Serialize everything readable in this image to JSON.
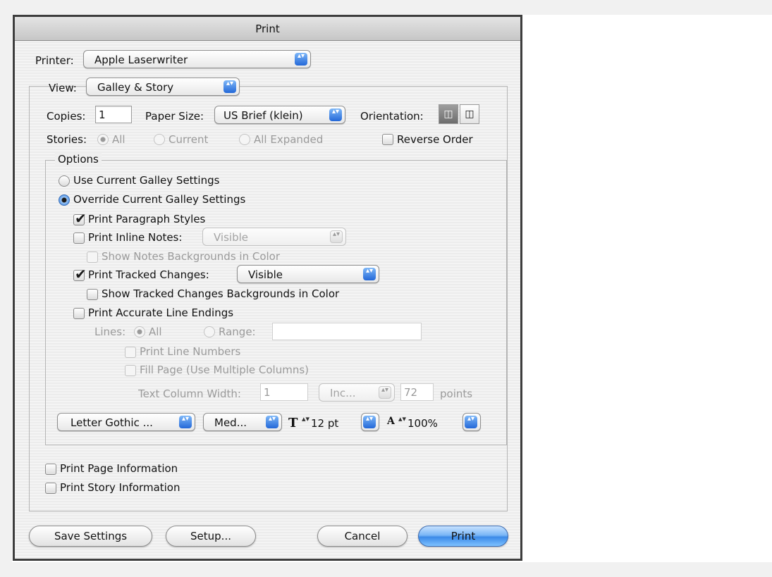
{
  "window": {
    "title": "Print"
  },
  "printer": {
    "label": "Printer:",
    "value": "Apple Laserwriter"
  },
  "view": {
    "label": "View:",
    "value": "Galley & Story"
  },
  "copies": {
    "label": "Copies:",
    "value": "1"
  },
  "paper_size": {
    "label": "Paper Size:",
    "value": "US Brief (klein)"
  },
  "orientation": {
    "label": "Orientation:"
  },
  "stories": {
    "label": "Stories:",
    "all": "All",
    "current": "Current",
    "all_expanded": "All Expanded"
  },
  "reverse_order": {
    "label": "Reverse Order",
    "checked": false
  },
  "options": {
    "group_label": "Options",
    "use_current": "Use Current Galley Settings",
    "override_current": "Override Current Galley Settings",
    "print_paragraph_styles": {
      "label": "Print Paragraph Styles",
      "checked": true
    },
    "print_inline_notes": {
      "label": "Print Inline Notes:",
      "checked": false,
      "value": "Visible"
    },
    "show_notes_backgrounds": {
      "label": "Show Notes Backgrounds in Color",
      "checked": false
    },
    "print_tracked_changes": {
      "label": "Print Tracked Changes:",
      "checked": true,
      "value": "Visible"
    },
    "show_tracked_backgrounds": {
      "label": "Show Tracked Changes Backgrounds in Color",
      "checked": false
    },
    "print_accurate_line_endings": {
      "label": "Print Accurate Line Endings",
      "checked": false
    },
    "lines": {
      "label": "Lines:",
      "all": "All",
      "range": "Range:",
      "range_value": ""
    },
    "print_line_numbers": "Print Line Numbers",
    "fill_page": "Fill Page (Use Multiple Columns)",
    "text_column_width": {
      "label": "Text Column Width:",
      "value": "1",
      "unit": "Inc...",
      "points_value": "72",
      "points_label": "points"
    },
    "font": "Letter Gothic ...",
    "font_style": "Med...",
    "font_size": "12 pt",
    "line_spacing": "100%"
  },
  "print_page_information": {
    "label": "Print Page Information",
    "checked": false
  },
  "print_story_information": {
    "label": "Print Story Information",
    "checked": false
  },
  "buttons": {
    "save_settings": "Save Settings",
    "setup": "Setup...",
    "cancel": "Cancel",
    "print": "Print"
  },
  "glyphs": {
    "checkmark": "✔",
    "popup_arrows": "▴▾",
    "stepper": "▴▾",
    "font_size_glyph": "T",
    "spacing_glyph": "A"
  },
  "colors": {
    "accent": "#3c8ae8",
    "disabled_text": "#9a9a9a"
  }
}
